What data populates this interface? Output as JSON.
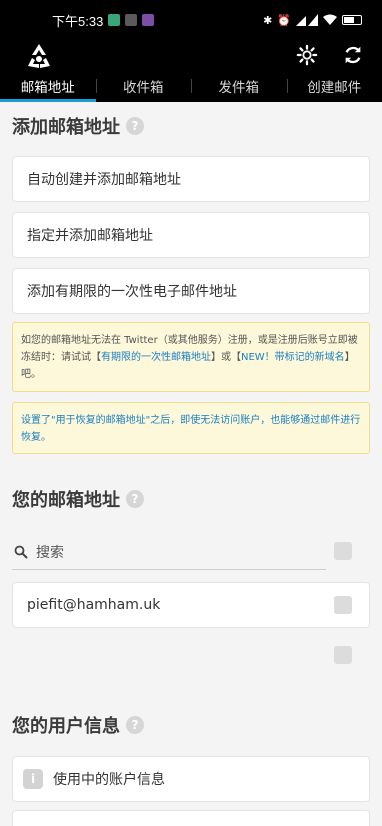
{
  "status_bar": {
    "time": "下午5:33",
    "icons": [
      "bluetooth-icon",
      "alarm-icon",
      "wifi-icon",
      "signal-icon",
      "battery-icon"
    ]
  },
  "app_bar": {
    "logo_icon": "recycle-logo-icon",
    "settings_icon": "gear-icon",
    "refresh_icon": "refresh-icon"
  },
  "tabs": [
    {
      "label": "邮箱地址",
      "active": true
    },
    {
      "label": "收件箱",
      "active": false
    },
    {
      "label": "发件箱",
      "active": false
    },
    {
      "label": "创建邮件",
      "active": false
    }
  ],
  "add_section": {
    "title": "添加邮箱地址",
    "actions": [
      "自动创建并添加邮箱地址",
      "指定并添加邮箱地址",
      "添加有期限的一次性电子邮件地址"
    ]
  },
  "notice1": {
    "text_a": "如您的邮箱地址无法在 Twitter（或其他服务）注册，或是注册后账号立即被冻结时：请试试【",
    "link_a": "有期限的一次性邮箱地址",
    "text_b": "】或【",
    "link_b": "NEW！带标记的新域名",
    "text_c": "】吧。"
  },
  "notice2": {
    "text": "设置了\"用于恢复的邮箱地址\"之后，即使无法访问账户，也能够通过邮件进行恢复。"
  },
  "emails_section": {
    "title": "您的邮箱地址",
    "search_placeholder": "搜索",
    "items": [
      "piefit@hamham.uk"
    ]
  },
  "user_section": {
    "title": "您的用户信息",
    "items": [
      "使用中的账户信息"
    ]
  },
  "colors": {
    "accent": "#1a9bd7",
    "notice_bg": "#fdf8d9",
    "bar_bg": "#000000"
  }
}
